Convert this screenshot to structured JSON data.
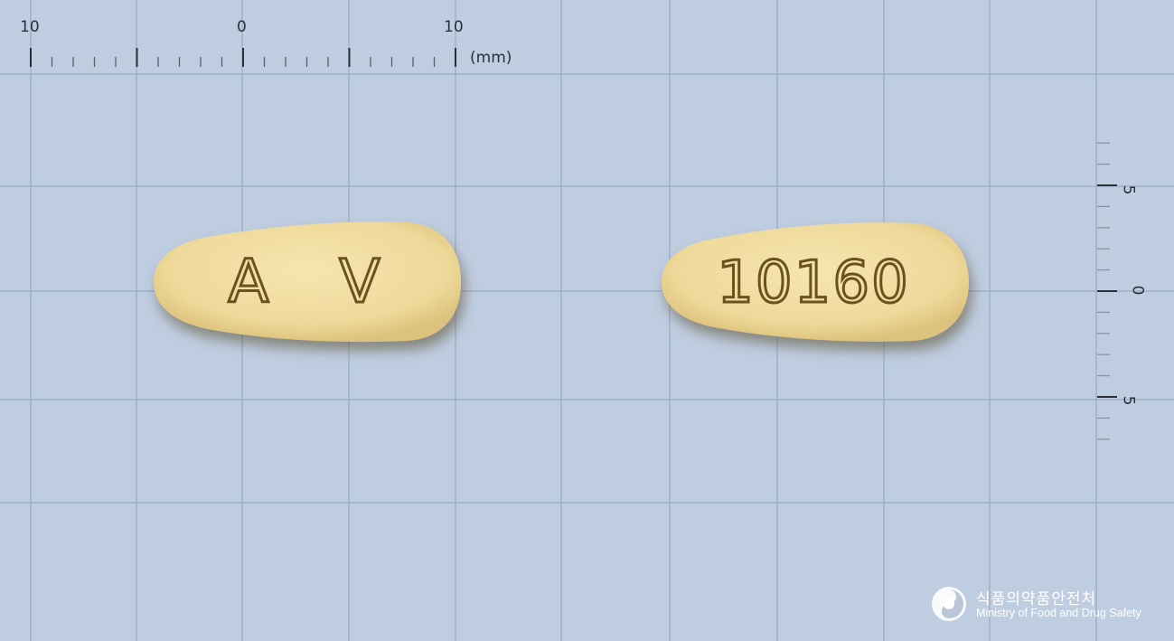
{
  "ruler_top": {
    "left_label": "10",
    "center_label": "0",
    "right_label": "10",
    "unit": "(mm)"
  },
  "ruler_right": {
    "top_label": "5",
    "center_label": "0",
    "bottom_label": "5"
  },
  "pill_front": {
    "imprint_left": "A",
    "imprint_right": "V"
  },
  "pill_back": {
    "imprint": "10160"
  },
  "pill_color": "#f2dfa0",
  "background_color": "#bfcde1",
  "grid_color": "#9fb0c8",
  "watermark": {
    "korean": "식품의약품안전처",
    "english": "Ministry of Food and Drug Safety"
  }
}
